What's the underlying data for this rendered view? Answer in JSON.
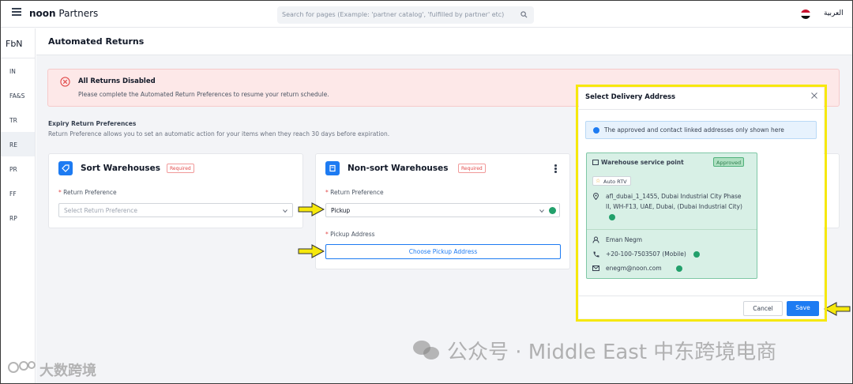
{
  "topbar": {
    "brand_bold": "noon",
    "brand_rest": " Partners",
    "search_placeholder": "Search for pages (Example: 'partner catalog', 'fulfilled by partner' etc)",
    "language": "العربية"
  },
  "sidebar": {
    "header": "FbN",
    "items": [
      {
        "label": "IN"
      },
      {
        "label": "FA&S"
      },
      {
        "label": "TR"
      },
      {
        "label": "RE",
        "active": true
      },
      {
        "label": "PR"
      },
      {
        "label": "FF"
      },
      {
        "label": "RP"
      }
    ]
  },
  "page": {
    "title": "Automated Returns"
  },
  "alert": {
    "title": "All Returns Disabled",
    "text": "Please complete the Automated Return Preferences to resume your return schedule."
  },
  "expiry": {
    "title": "Expiry Return Preferences",
    "description": "Return Preference allows you to set an automatic action for your items when they reach 30 days before expiration."
  },
  "sort_card": {
    "title": "Sort Warehouses",
    "badge": "Required",
    "field_label": "Return Preference",
    "placeholder": "Select Return Preference"
  },
  "nonsort_card": {
    "title": "Non-sort Warehouses",
    "badge": "Required",
    "field_label": "Return Preference",
    "value": "Pickup",
    "pickup_label": "Pickup Address",
    "choose_button": "Choose Pickup Address"
  },
  "modal": {
    "title": "Select Delivery Address",
    "info": "The approved and contact linked addresses only shown here",
    "address": {
      "name": "Warehouse service point",
      "status": "Approved",
      "tag": "Auto RTV",
      "line1": "afl_dubai_1_1455, Dubai Industrial City Phase",
      "line2": "II, WH-F13, UAE, Dubai, (Dubai Industrial City)",
      "contact": "Eman Negm",
      "phone": "+20-100-7503507 (Mobile)",
      "email": "enegm@noon.com"
    },
    "cancel": "Cancel",
    "save": "Save"
  },
  "watermark": {
    "right": "公众号 · Middle East 中东跨境电商",
    "left": "大数跨境"
  },
  "colors": {
    "accent": "#1d7bf2",
    "highlight": "#f6e80c",
    "success": "#22a06b",
    "alert_bg": "#fde8e8"
  }
}
